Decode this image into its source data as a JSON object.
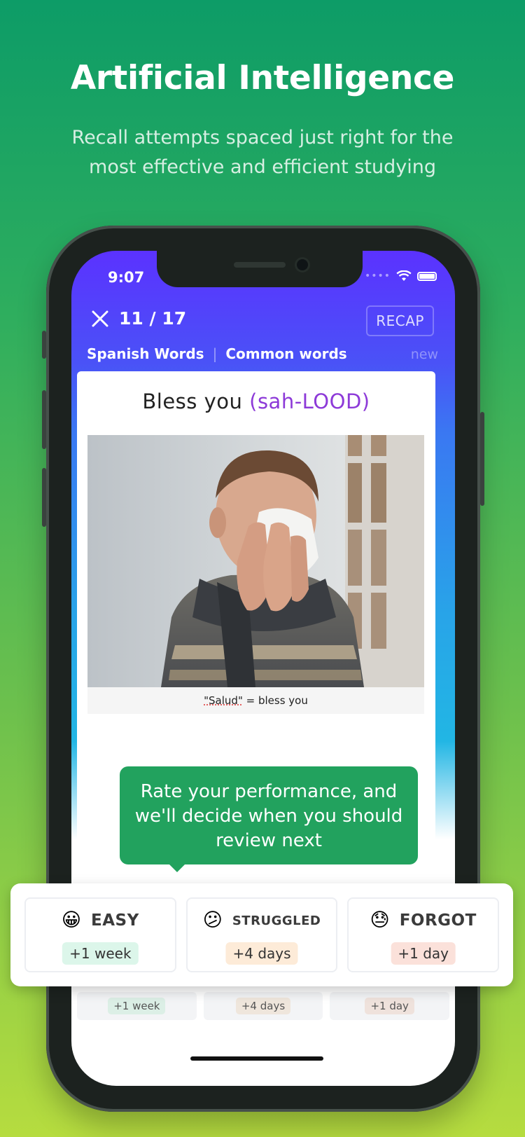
{
  "headline": "Artificial Intelligence",
  "subheadline": "Recall attempts spaced just right for the most effective and efficient studying",
  "status_bar": {
    "time": "9:07"
  },
  "lesson": {
    "progress": "11 / 17",
    "recap_label": "RECAP",
    "breadcrumb": [
      "Spanish Words",
      "Common words"
    ],
    "breadcrumb_separator": "|",
    "tag": "new"
  },
  "card": {
    "phrase": "Bless you",
    "pronunciation": "(sah-LOOD)",
    "caption_word": "\"Salud\"",
    "caption_rest": " = bless you"
  },
  "tooltip": "Rate your performance, and we'll decide when you should review next",
  "ratings": [
    {
      "emoji": "😀",
      "label": "EASY",
      "interval": "+1 week",
      "pill_color": "#dcf6ea"
    },
    {
      "emoji": "😕",
      "label": "STRUGGLED",
      "interval": "+4 days",
      "pill_color": "#fdebd8"
    },
    {
      "emoji": "😓",
      "label": "FORGOT",
      "interval": "+1 day",
      "pill_color": "#fbe1da"
    }
  ],
  "bottom_strip": [
    "+1 week",
    "+4 days",
    "+1 day"
  ],
  "colors": {
    "accent": "#22a25e",
    "header": "#5b32ff",
    "pronunciation": "#8d3ad8"
  }
}
